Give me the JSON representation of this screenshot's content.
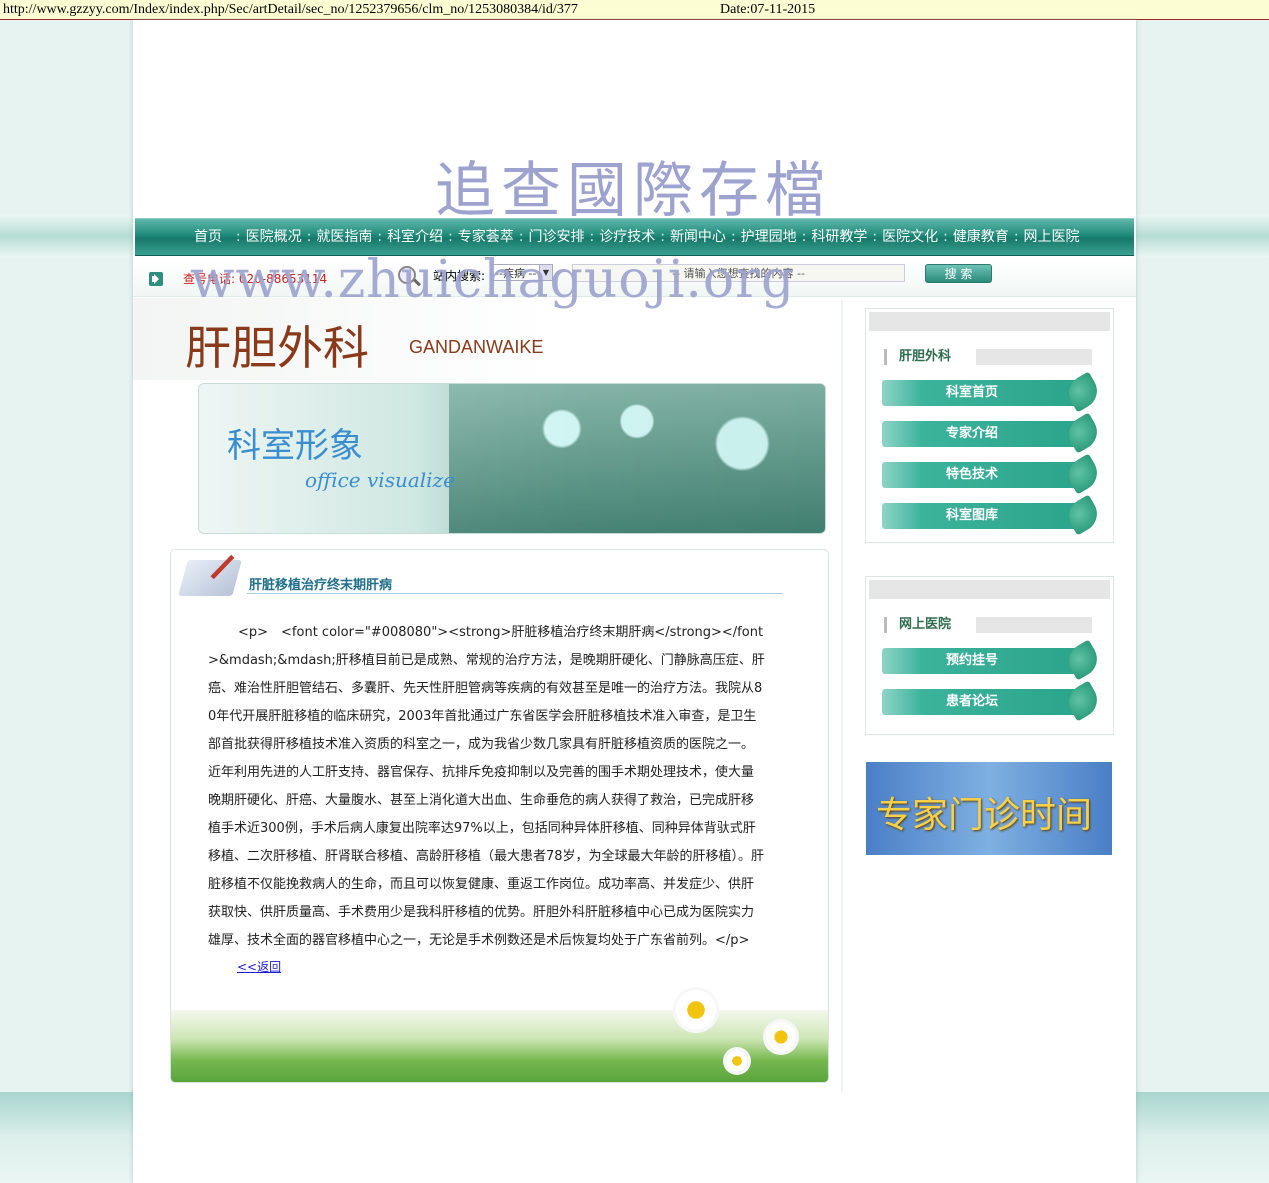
{
  "archive": {
    "url": "http://www.gzzyy.com/Index/index.php/Sec/artDetail/sec_no/1252379656/clm_no/1253080384/id/377",
    "date": "Date:07-11-2015"
  },
  "watermark": {
    "title": "追查國際存檔",
    "url": "www.zhuichaguoji.org"
  },
  "nav": {
    "items": [
      "首页",
      "医院概况",
      "就医指南",
      "科室介绍",
      "专家荟萃",
      "门诊安排",
      "诊疗技术",
      "新闻中心",
      "护理园地",
      "科研教学",
      "医院文化",
      "健康教育",
      "网上医院"
    ]
  },
  "utility": {
    "hotline_label": "查号电话:",
    "hotline_number": "020-88653114",
    "search_label": "站内搜索:",
    "search_category": "--疾病 --",
    "search_placeholder": "-- 请输入您想查找的内容 --",
    "search_button": "搜 索"
  },
  "department": {
    "title_cn": "肝胆外科",
    "title_pinyin": "GANDANWAIKE"
  },
  "banner": {
    "title_cn": "科室形象",
    "title_en": "office visualize"
  },
  "article": {
    "title": "肝脏移植治疗终末期肝病",
    "body": "<p>　<font color=\"#008080\"><strong>肝脏移植治疗终末期肝病</strong></font>&mdash;&mdash;肝移植目前已是成熟、常规的治疗方法，是晚期肝硬化、门静脉高压症、肝癌、难治性肝胆管结石、多囊肝、先天性肝胆管病等疾病的有效甚至是唯一的治疗方法。我院从80年代开展肝脏移植的临床研究，2003年首批通过广东省医学会肝脏移植技术准入审查，是卫生部首批获得肝移植技术准入资质的科室之一，成为我省少数几家具有肝脏移植资质的医院之一。近年利用先进的人工肝支持、器官保存、抗排斥免疫抑制以及完善的围手术期处理技术，使大量晚期肝硬化、肝癌、大量腹水、甚至上消化道大出血、生命垂危的病人获得了救治，已完成肝移植手术近300例，手术后病人康复出院率达97%以上，包括同种异体肝移植、同种异体背驮式肝移植、二次肝移植、肝肾联合移植、高龄肝移植（最大患者78岁，为全球最大年龄的肝移植）。肝脏移植不仅能挽救病人的生命，而且可以恢复健康、重返工作岗位。成功率高、并发症少、供肝获取快、供肝质量高、手术费用少是我科肝移植的优势。肝胆外科肝脏移植中心已成为医院实力雄厚、技术全面的器官移植中心之一，无论是手术例数还是术后恢复均处于广东省前列。</p>",
    "back_link": "<<返回"
  },
  "sidebar": {
    "dept_box": {
      "heading": "肝胆外科",
      "items": [
        "科室首页",
        "专家介绍",
        "特色技术",
        "科室图库"
      ]
    },
    "online_box": {
      "heading": "网上医院",
      "items": [
        "预约挂号",
        "患者论坛"
      ]
    },
    "promo_text": "专家门诊时间"
  }
}
